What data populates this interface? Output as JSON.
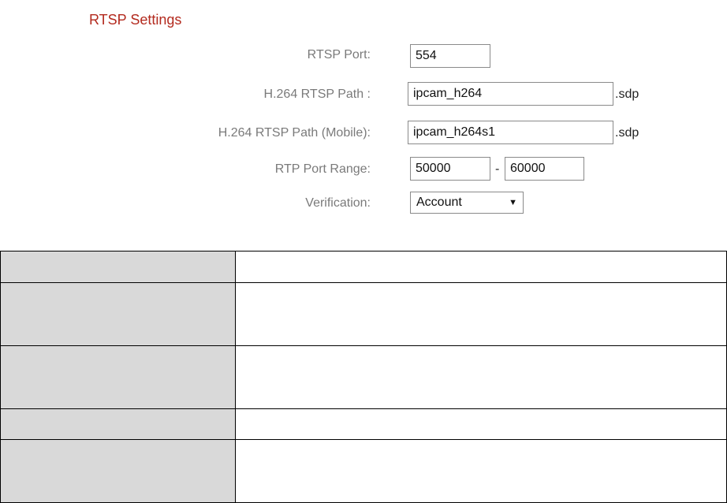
{
  "section": {
    "title": "RTSP Settings",
    "title_color": "#b32a1e"
  },
  "fields": {
    "rtsp_port": {
      "label": "RTSP Port:",
      "value": "554"
    },
    "h264_path": {
      "label": "H.264 RTSP Path :",
      "value": "ipcam_h264",
      "suffix": ".sdp"
    },
    "h264_mobile_path": {
      "label": "H.264 RTSP Path (Mobile):",
      "value": "ipcam_h264s1",
      "suffix": ".sdp"
    },
    "rtp_port_range": {
      "label": "RTP Port Range:",
      "start": "50000",
      "separator": "-",
      "end": "60000"
    },
    "verification": {
      "label": "Verification:",
      "selected": "Account"
    }
  },
  "table": {
    "header_bg": "#d9d9d9",
    "rows": 5
  }
}
